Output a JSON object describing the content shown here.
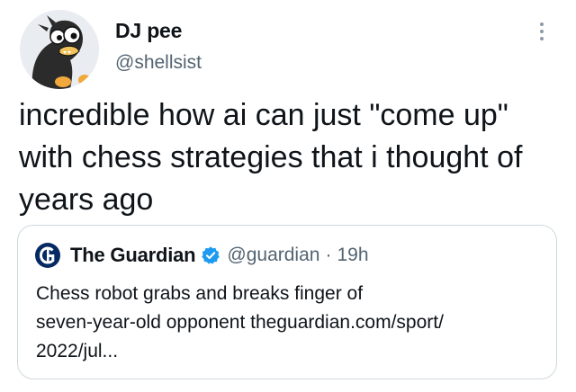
{
  "author": {
    "display_name": "DJ pee",
    "handle": "@shellsist",
    "avatar_icon": "cartoon-bird-avatar"
  },
  "tweet": {
    "text": "incredible how ai can just \"come up\"\nwith chess strategies that i thought of\nyears ago"
  },
  "quoted_tweet": {
    "source_name": "The Guardian",
    "source_logo_icon": "guardian-logo",
    "verified": true,
    "handle": "@guardian",
    "separator": "·",
    "time": "19h",
    "text": "Chess robot grabs and breaks finger of\nseven-year-old opponent theguardian.com/sport/\n2022/jul..."
  },
  "colors": {
    "text_primary": "#0f1419",
    "text_secondary": "#536471",
    "verified_blue": "#1d9bf0",
    "guardian_navy": "#052962",
    "card_border": "#cfd9de"
  },
  "more_icon": "more-horizontal-dots-icon"
}
